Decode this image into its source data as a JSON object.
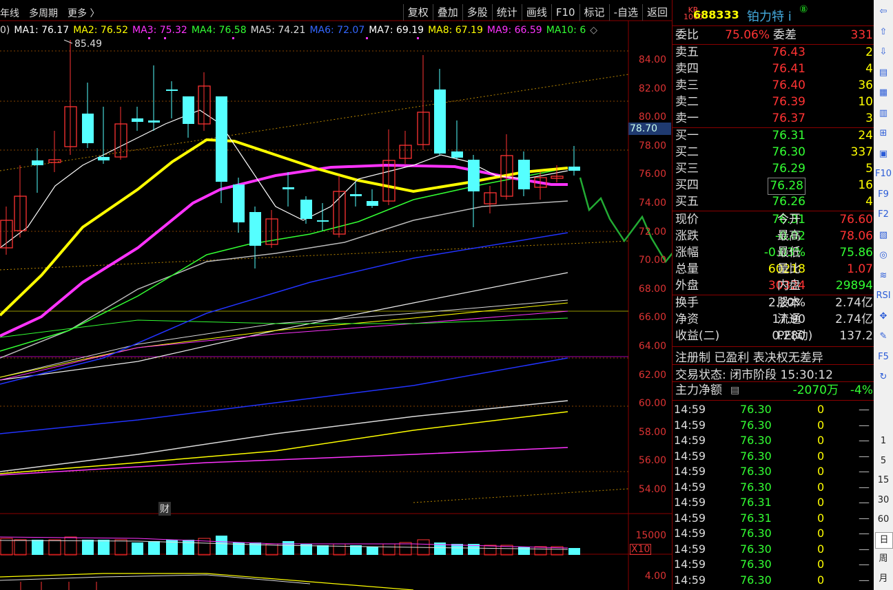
{
  "topbar": {
    "left_items": [
      "年线",
      "多周期",
      "更多 〉"
    ],
    "buttons": [
      "复权",
      "叠加",
      "多股",
      "统计",
      "画线",
      "F10",
      "标记",
      "-自选",
      "返回"
    ]
  },
  "ma_bar": [
    {
      "label": "0)",
      "color": "#dddddd"
    },
    {
      "label": "MA1: 76.17",
      "color": "#ffffff"
    },
    {
      "label": "MA2: 76.52",
      "color": "#ffff00"
    },
    {
      "label": "MA3: 75.32",
      "color": "#ff33ff"
    },
    {
      "label": "MA4: 76.58",
      "color": "#33ff33"
    },
    {
      "label": "MA5: 74.21",
      "color": "#dddddd"
    },
    {
      "label": "MA6: 72.07",
      "color": "#3366ff"
    },
    {
      "label": "MA7: 69.19",
      "color": "#ffffff"
    },
    {
      "label": "MA8: 67.19",
      "color": "#ffff00"
    },
    {
      "label": "MA9: 66.59",
      "color": "#ff33ff"
    },
    {
      "label": "MA10: 6",
      "color": "#33ff33"
    },
    {
      "label": "◇",
      "color": "#aaaaaa"
    }
  ],
  "peak_label": "85.49",
  "price_axis": [
    "84.00",
    "82.00",
    "80.00",
    "78.00",
    "76.00",
    "74.00",
    "72.00",
    "70.00",
    "68.00",
    "66.00",
    "64.00",
    "62.00",
    "60.00",
    "58.00",
    "56.00",
    "54.00"
  ],
  "current_marker": "78.70",
  "cai_label": "财",
  "vol_axis": {
    "top": "15000",
    "unit": "X10",
    "macd": "4.00"
  },
  "quote": {
    "kr_badge": "KR\n1000",
    "code": "688333",
    "name": "铂力特 i",
    "badge": "⑧",
    "weibi_label": "委比",
    "weibi": "75.06%",
    "weicha_label": "委差",
    "weicha": "331",
    "asks": [
      {
        "label": "卖五",
        "price": "76.43",
        "vol": "2"
      },
      {
        "label": "卖四",
        "price": "76.41",
        "vol": "4"
      },
      {
        "label": "卖三",
        "price": "76.40",
        "vol": "36"
      },
      {
        "label": "卖二",
        "price": "76.39",
        "vol": "10"
      },
      {
        "label": "卖一",
        "price": "76.37",
        "vol": "3"
      }
    ],
    "bids": [
      {
        "label": "买一",
        "price": "76.31",
        "vol": "24"
      },
      {
        "label": "买二",
        "price": "76.30",
        "vol": "337"
      },
      {
        "label": "买三",
        "price": "76.29",
        "vol": "5"
      },
      {
        "label": "买四",
        "price": "76.28",
        "vol": "16"
      },
      {
        "label": "买五",
        "price": "76.26",
        "vol": "4"
      }
    ],
    "stats": [
      {
        "l1": "现价",
        "v1": "76.31",
        "c1": "green",
        "l2": "今开",
        "v2": "76.60",
        "c2": "red"
      },
      {
        "l1": "涨跌",
        "v1": "-0.02",
        "c1": "green",
        "l2": "最高",
        "v2": "78.06",
        "c2": "red"
      },
      {
        "l1": "涨幅",
        "v1": "-0.03%",
        "c1": "green",
        "l2": "最低",
        "v2": "75.86",
        "c2": "green"
      },
      {
        "l1": "总量",
        "v1": "60218",
        "c1": "yellow",
        "l2": "量比",
        "v2": "1.07",
        "c2": "red"
      },
      {
        "l1": "外盘",
        "v1": "30324",
        "c1": "red",
        "l2": "内盘",
        "v2": "29894",
        "c2": "green"
      }
    ],
    "stats2": [
      {
        "l1": "换手",
        "v1": "2.20%",
        "l2": "股本",
        "v2": "2.74亿"
      },
      {
        "l1": "净资",
        "v1": "17.90",
        "l2": "流通",
        "v2": "2.74亿"
      },
      {
        "l1": "收益(二)",
        "v1": "0.280",
        "l2": "PE(动)",
        "v2": "137.2"
      }
    ],
    "reg_text": "注册制 已盈利 表决权无差异",
    "status_label": "交易状态:",
    "status_value": "闭市阶段 15:30:12",
    "flow_label": "主力净额",
    "flow_value": "-2070万",
    "flow_pct": "-4%",
    "ticks": [
      {
        "t": "14:59",
        "p": "76.30",
        "v": "0",
        "d": "—"
      },
      {
        "t": "14:59",
        "p": "76.30",
        "v": "0",
        "d": "—"
      },
      {
        "t": "14:59",
        "p": "76.30",
        "v": "0",
        "d": "—"
      },
      {
        "t": "14:59",
        "p": "76.30",
        "v": "0",
        "d": "—"
      },
      {
        "t": "14:59",
        "p": "76.30",
        "v": "0",
        "d": "—"
      },
      {
        "t": "14:59",
        "p": "76.30",
        "v": "0",
        "d": "—"
      },
      {
        "t": "14:59",
        "p": "76.31",
        "v": "0",
        "d": "—"
      },
      {
        "t": "14:59",
        "p": "76.31",
        "v": "0",
        "d": "—"
      },
      {
        "t": "14:59",
        "p": "76.30",
        "v": "0",
        "d": "—"
      },
      {
        "t": "14:59",
        "p": "76.30",
        "v": "0",
        "d": "—"
      },
      {
        "t": "14:59",
        "p": "76.30",
        "v": "0",
        "d": "—"
      },
      {
        "t": "14:59",
        "p": "76.30",
        "v": "0",
        "d": "—"
      }
    ]
  },
  "toolbar": [
    "⇦",
    "⇧",
    "⇩",
    "▤",
    "▦",
    "▥",
    "⊞",
    "▣",
    "F10",
    "F9",
    "F2",
    "▧",
    "◎",
    "≋",
    "RSI",
    "✥",
    "✎",
    "F5",
    "↻",
    "1",
    "5",
    "15",
    "30",
    "60",
    "日",
    "周",
    "月"
  ],
  "colors": {
    "up": "#ff3333",
    "down": "#55ffff",
    "ma1": "#ffffff",
    "ma2": "#ffff00",
    "ma3": "#ff33ff",
    "ma4": "#33ff33",
    "ma6": "#2233ff",
    "drawing": "#22aa33"
  }
}
